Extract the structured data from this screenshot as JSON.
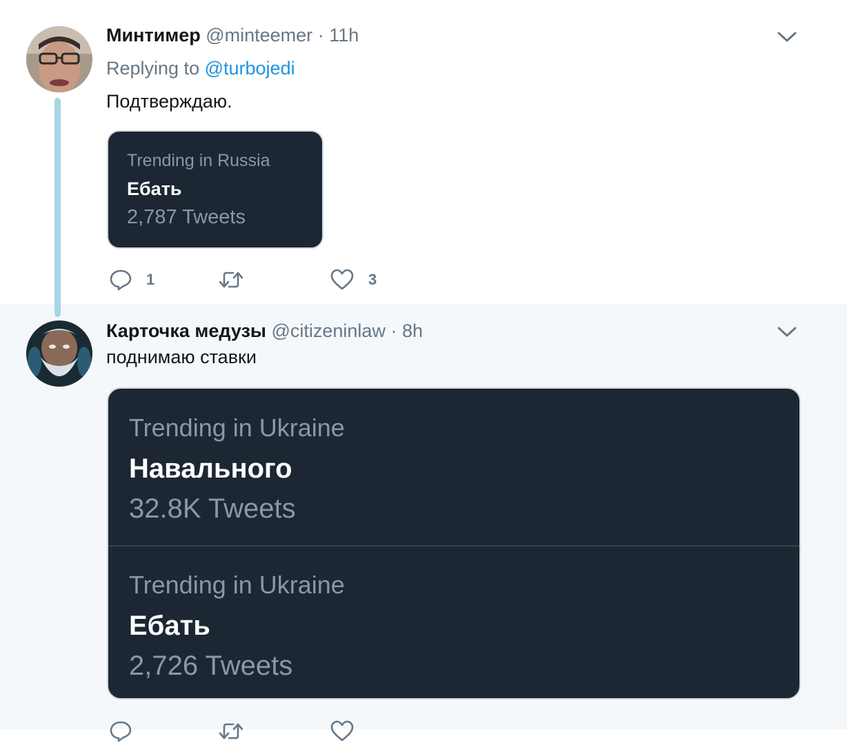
{
  "tweets": [
    {
      "author_name": "Минтимер",
      "handle": "@minteemer",
      "time": "11h",
      "replying_prefix": "Replying to",
      "replying_to": "@turbojedi",
      "text": "Подтверждаю.",
      "card": [
        {
          "label": "Trending in Russia",
          "name": "Ебать",
          "count": "2,787 Tweets"
        }
      ],
      "actions": {
        "replies": "1",
        "retweets": "",
        "likes": "3"
      },
      "icons": [
        "avatar",
        "chevron-down-icon",
        "reply-icon",
        "retweet-icon",
        "heart-icon"
      ]
    },
    {
      "author_name": "Карточка медузы",
      "handle": "@citizeninlaw",
      "time": "8h",
      "text": "поднимаю ставки",
      "card": [
        {
          "label": "Trending in Ukraine",
          "name": "Навального",
          "count": "32.8K Tweets"
        },
        {
          "label": "Trending in Ukraine",
          "name": "Ебать",
          "count": "2,726 Tweets"
        }
      ],
      "icons": [
        "avatar",
        "chevron-down-icon",
        "reply-icon",
        "retweet-icon",
        "heart-icon"
      ]
    }
  ],
  "colors": {
    "thread_line": "#a8d4e6",
    "link": "#1b95e0",
    "card_background": "#1c2733",
    "muted_text": "#657786",
    "second_tweet_background": "#f5f8fa"
  },
  "separator": "·"
}
